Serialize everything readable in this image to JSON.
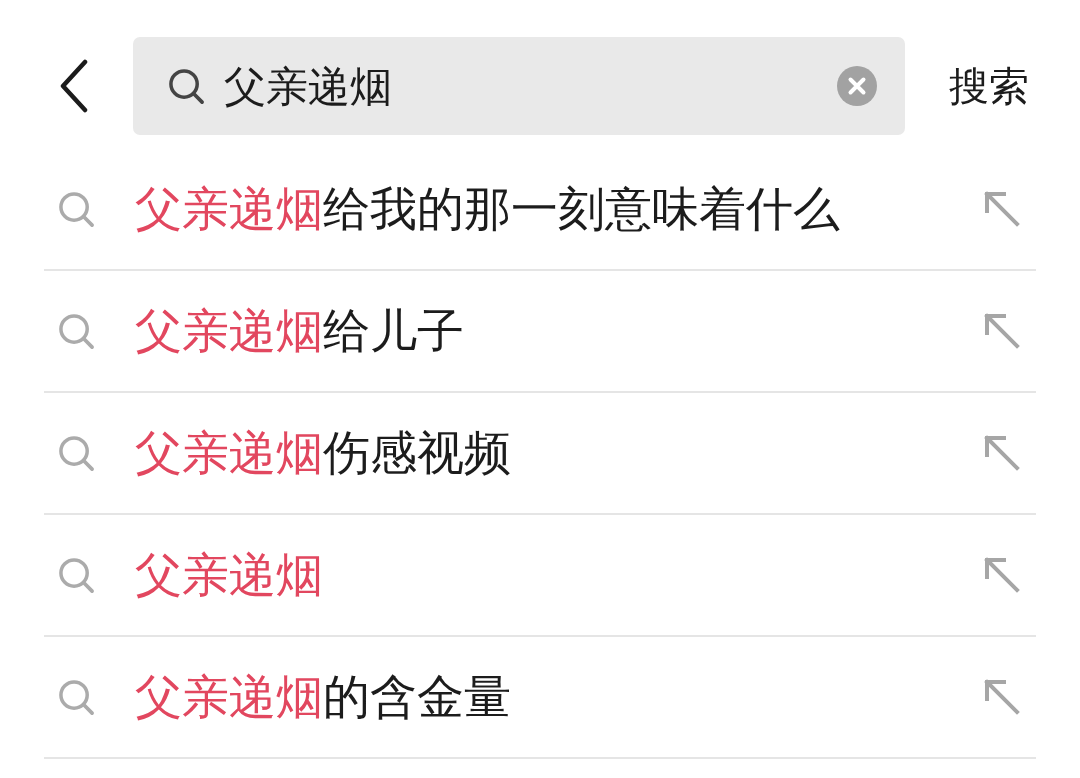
{
  "header": {
    "search": {
      "value": "父亲递烟"
    },
    "search_button": "搜索"
  },
  "suggestions": [
    {
      "match": "父亲递烟",
      "rest": "给我的那一刻意味着什么"
    },
    {
      "match": "父亲递烟",
      "rest": "给儿子"
    },
    {
      "match": "父亲递烟",
      "rest": "伤感视频"
    },
    {
      "match": "父亲递烟"
    },
    {
      "match": "父亲递烟",
      "rest": "的含金量"
    }
  ]
}
